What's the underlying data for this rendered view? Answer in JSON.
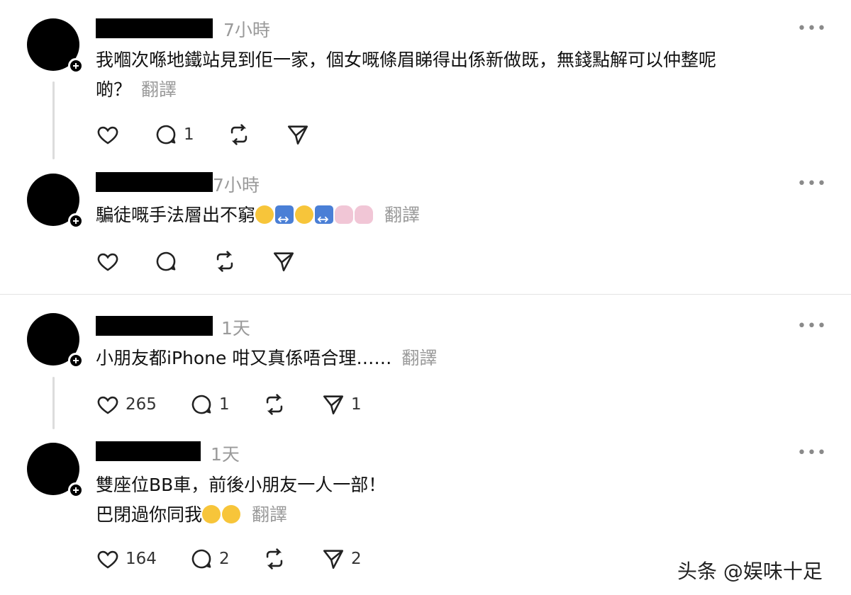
{
  "posts": [
    {
      "time": "7小時",
      "text_line1": "我嗰次喺地鐵站見到佢一家，個女嘅條眉睇得出係新做既，無錢點解可以仲整呢",
      "text_line2": "啲？",
      "translate": "翻譯",
      "counts": {
        "like": "",
        "reply": "1",
        "repost": "",
        "share": ""
      }
    },
    {
      "time": "7小時",
      "text_line1": "騙徒嘅手法層出不窮",
      "emojis": [
        "slightly-smiling-face",
        "left-right-arrow",
        "slightly-smiling-face",
        "left-right-arrow",
        "person-shrugging",
        "person-shrugging"
      ],
      "translate": "翻譯",
      "counts": {
        "like": "",
        "reply": "",
        "repost": "",
        "share": ""
      }
    },
    {
      "time": "1天",
      "text_line1": "小朋友都iPhone 咁又真係唔合理……",
      "translate": "翻譯",
      "counts": {
        "like": "265",
        "reply": "1",
        "repost": "",
        "share": "1"
      }
    },
    {
      "time": "1天",
      "text_line1": "雙座位BB車，前後小朋友一人一部！",
      "text_line2": "巴閉過你同我",
      "emojis": [
        "face-with-tears-of-joy",
        "face-with-tears-of-joy"
      ],
      "translate": "翻譯",
      "counts": {
        "like": "164",
        "reply": "2",
        "repost": "",
        "share": "2"
      }
    }
  ],
  "more_label": "•••",
  "watermark": "头条 @娱味十足"
}
